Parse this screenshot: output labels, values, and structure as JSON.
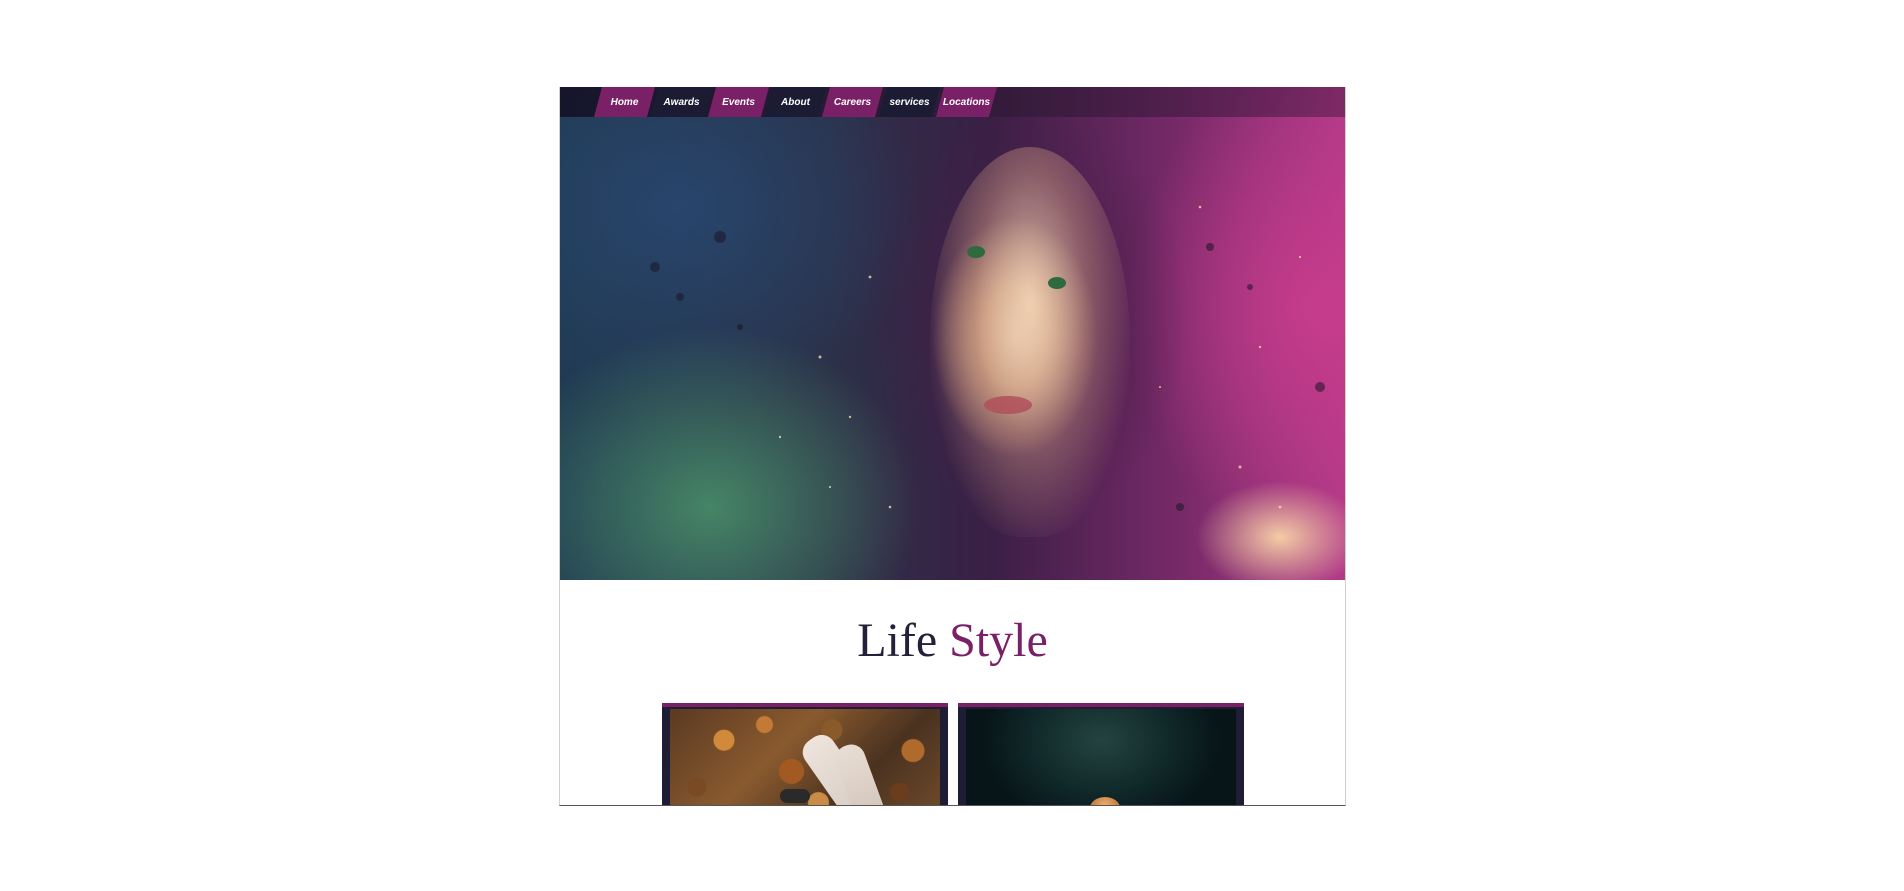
{
  "nav": {
    "items": [
      {
        "label": "Home",
        "style": "purple"
      },
      {
        "label": "Awards",
        "style": "dark"
      },
      {
        "label": "Events",
        "style": "purple"
      },
      {
        "label": "About",
        "style": "dark"
      },
      {
        "label": "Careers",
        "style": "purple"
      },
      {
        "label": "services",
        "style": "dark"
      },
      {
        "label": "Locations",
        "style": "purple"
      }
    ]
  },
  "section": {
    "title_word1": "Life",
    "title_word2": "Style"
  },
  "colors": {
    "accent": "#7a2066",
    "dark": "#1b1c34",
    "title_dark": "#23203a"
  }
}
